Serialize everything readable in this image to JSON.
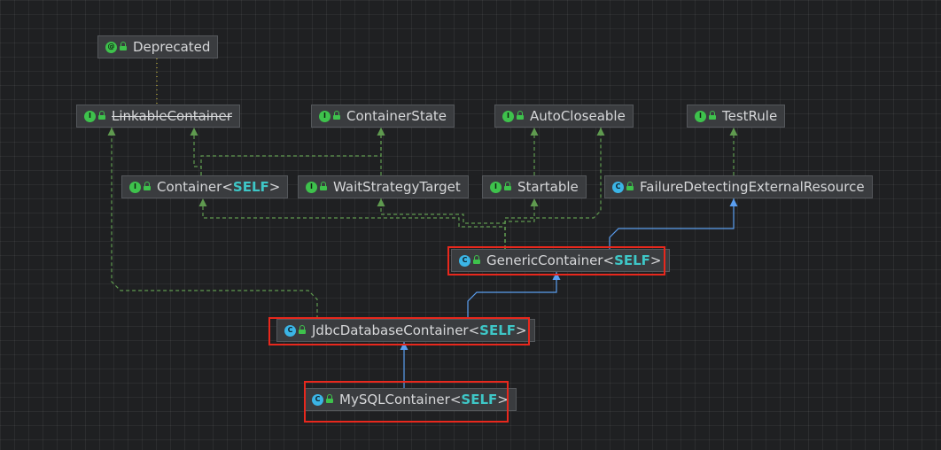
{
  "nodes": {
    "deprecated": {
      "kind": "annotation",
      "badge": "@",
      "name": "Deprecated"
    },
    "linkable_container": {
      "kind": "interface",
      "badge": "I",
      "name": "LinkableContainer",
      "deprecated": true
    },
    "container_state": {
      "kind": "interface",
      "badge": "I",
      "name": "ContainerState"
    },
    "auto_closeable": {
      "kind": "interface",
      "badge": "I",
      "name": "AutoCloseable"
    },
    "test_rule": {
      "kind": "interface",
      "badge": "I",
      "name": "TestRule"
    },
    "container": {
      "kind": "interface",
      "badge": "I",
      "name": "Container",
      "lt": "<",
      "type_param": "SELF",
      "gt": ">"
    },
    "wait_strategy_target": {
      "kind": "interface",
      "badge": "I",
      "name": "WaitStrategyTarget"
    },
    "startable": {
      "kind": "interface",
      "badge": "I",
      "name": "Startable"
    },
    "failure_detecting": {
      "kind": "class",
      "badge": "C",
      "name": "FailureDetectingExternalResource"
    },
    "generic_container": {
      "kind": "class",
      "badge": "C",
      "name": "GenericContainer",
      "lt": "<",
      "type_param": "SELF",
      "gt": ">"
    },
    "jdbc_database_container": {
      "kind": "abstract",
      "badge": "C",
      "name": "JdbcDatabaseContainer",
      "lt": "<",
      "type_param": "SELF",
      "gt": ">"
    },
    "mysql_container": {
      "kind": "class",
      "badge": "C",
      "name": "MySQLContainer",
      "lt": "<",
      "type_param": "SELF",
      "gt": ">"
    }
  },
  "colors": {
    "implements_edge": "#5f9a4f",
    "extends_edge": "#5a9ef0",
    "annotation_edge": "#c9b73a",
    "highlight_box": "#e8281d",
    "type_param": "#3ec7c7"
  },
  "edges": [
    {
      "from": "deprecated",
      "to": "linkable_container",
      "type": "annotation"
    },
    {
      "from": "container",
      "to": "linkable_container",
      "type": "implements"
    },
    {
      "from": "container",
      "to": "container_state",
      "type": "implements"
    },
    {
      "from": "wait_strategy_target",
      "to": "container_state",
      "type": "implements"
    },
    {
      "from": "startable",
      "to": "auto_closeable",
      "type": "implements"
    },
    {
      "from": "failure_detecting",
      "to": "test_rule",
      "type": "implements"
    },
    {
      "from": "generic_container",
      "to": "container",
      "type": "implements"
    },
    {
      "from": "generic_container",
      "to": "wait_strategy_target",
      "type": "implements"
    },
    {
      "from": "generic_container",
      "to": "startable",
      "type": "implements"
    },
    {
      "from": "generic_container",
      "to": "auto_closeable",
      "type": "implements"
    },
    {
      "from": "generic_container",
      "to": "failure_detecting",
      "type": "extends"
    },
    {
      "from": "jdbc_database_container",
      "to": "generic_container",
      "type": "extends"
    },
    {
      "from": "jdbc_database_container",
      "to": "linkable_container",
      "type": "implements"
    },
    {
      "from": "mysql_container",
      "to": "jdbc_database_container",
      "type": "extends"
    }
  ],
  "highlighted": [
    "generic_container",
    "jdbc_database_container",
    "mysql_container"
  ]
}
